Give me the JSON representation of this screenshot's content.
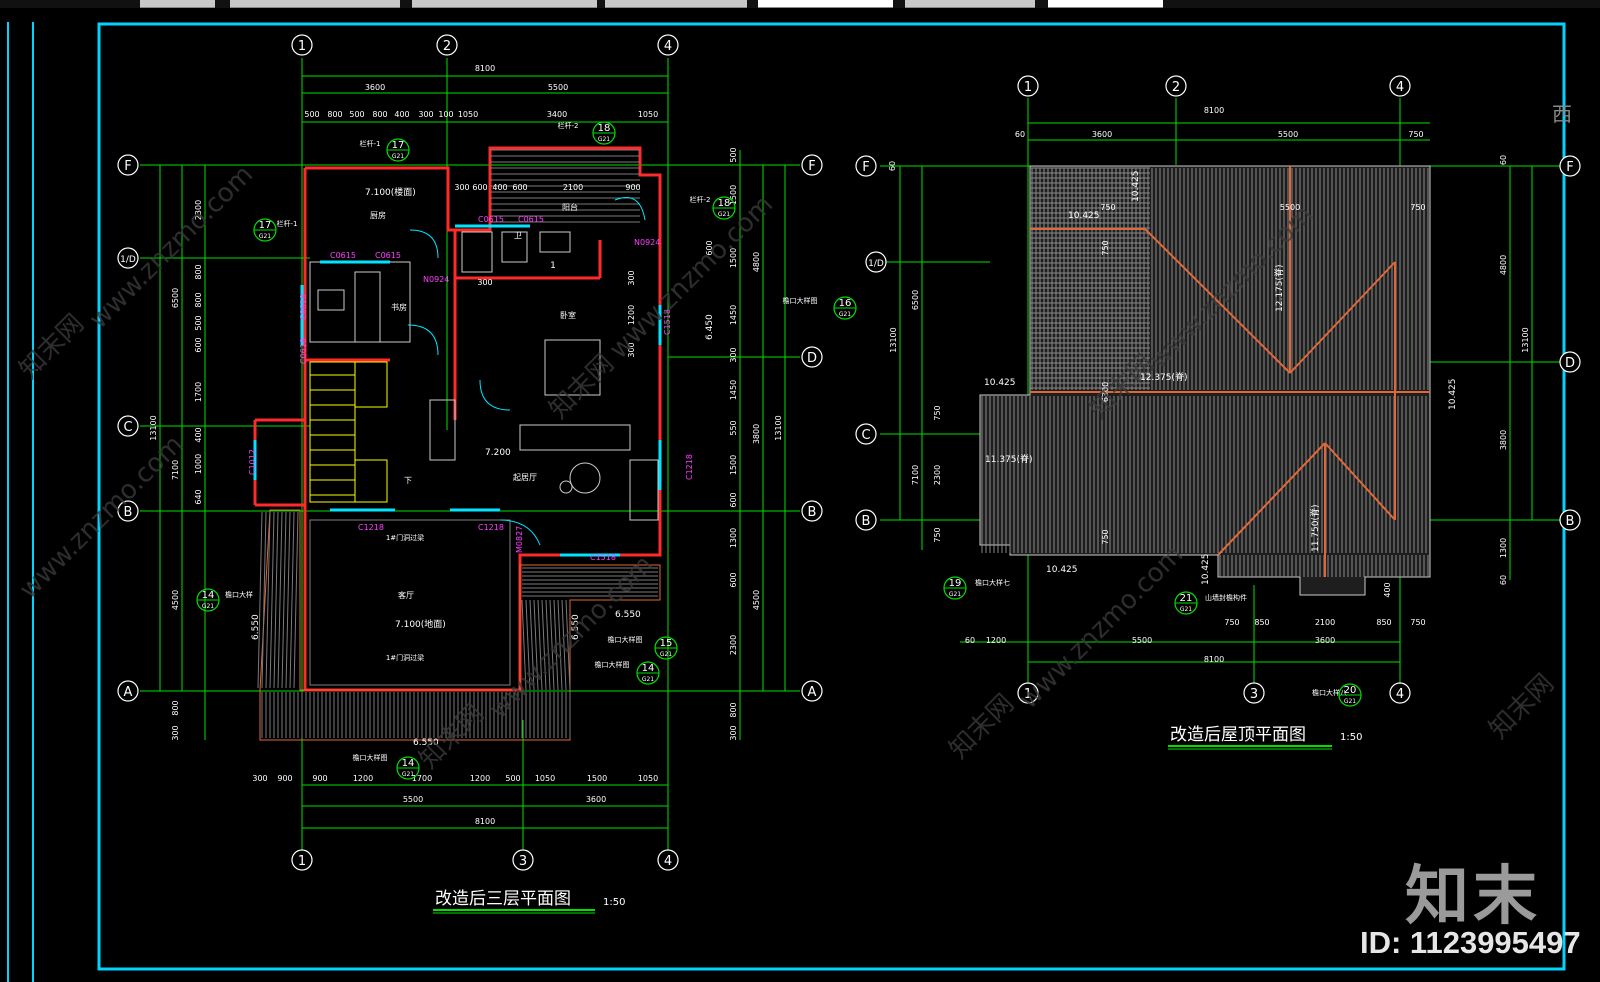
{
  "colors": {
    "background": "#000000",
    "frame": "#00d4ff",
    "dimension": "#00e000",
    "wall": "#ff2a2a",
    "window": "#00e5ff",
    "text": "#ffffff",
    "tag": "#ff40ff",
    "stair": "#ffff00",
    "roof": "#e06838",
    "hatch": "#808080"
  },
  "watermark": {
    "logo": "知末",
    "id": "ID: 1123995497",
    "site": "www.znzmo.com",
    "site_cn": "知末网",
    "side_char": "西"
  },
  "plan3": {
    "title": "改造后三层平面图",
    "scale": "1:50",
    "axes_top": [
      "1",
      "2",
      "4"
    ],
    "axes_bottom": [
      "1",
      "3",
      "4"
    ],
    "axes_rows": [
      "F",
      "1/D",
      "C",
      "B",
      "A"
    ],
    "axes_rows_right": [
      "F",
      "D",
      "B",
      "A"
    ],
    "dim_total_top": "8100",
    "dim_top_mid": [
      "3600",
      "5500"
    ],
    "dim_top_detail": [
      "500",
      "800",
      "500",
      "800",
      "400",
      "300",
      "100",
      "1050",
      "3400",
      "1050"
    ],
    "dim_bottom_detail": [
      "300",
      "900",
      "900",
      "1200",
      "1700",
      "1200",
      "500",
      "1050",
      "1500",
      "1050"
    ],
    "dim_bottom_mid": [
      "5500",
      "3600"
    ],
    "dim_total_bottom": "8100",
    "dim_left_outer": "13100",
    "dim_left_mid": [
      "6500",
      "7100",
      "4500"
    ],
    "dim_left_detail": [
      "2300",
      "800",
      "800",
      "500",
      "600",
      "1700",
      "400",
      "1000",
      "640"
    ],
    "dim_left_tail": [
      "800",
      "300"
    ],
    "dim_right_detail": [
      "500",
      "1500",
      "600",
      "1500",
      "300",
      "1200",
      "300",
      "1450",
      "550",
      "1500",
      "600",
      "1300",
      "600",
      "2300"
    ],
    "dim_right_tail": [
      "800",
      "300"
    ],
    "dim_right_mid": [
      "4800",
      "3800",
      "4500"
    ],
    "dim_right_outer": "13100",
    "dim_interior": [
      "300",
      "600",
      "400",
      "600",
      "2100",
      "900",
      "900"
    ],
    "room_labels": [
      "厨房",
      "阳台",
      "卧室",
      "书房",
      "起居厅",
      "卫",
      "客厅",
      "下"
    ],
    "room_sub": "1",
    "levels": [
      "7.100(楼面)",
      "7.200",
      "7.100(地面)",
      "6.550",
      "6.550",
      "6.550",
      "6.450",
      "6.550"
    ],
    "notes": [
      "1#门洞过梁",
      "1#门洞过梁",
      "栏杆-2",
      "栏杆-2",
      "栏杆-1",
      "檐口大样图",
      "檐口大样",
      "檐口大样图",
      "檐口大样图",
      "檐口大样图"
    ],
    "window_tags": [
      "C0615",
      "C0615",
      "C0615",
      "C0615",
      "N0924",
      "N0924",
      "C0618",
      "C0618",
      "C1518",
      "C1012",
      "C1218",
      "C1218",
      "C1218",
      "M0827",
      "C1518"
    ],
    "callouts": [
      {
        "num": "17",
        "ref": "G21"
      },
      {
        "num": "18",
        "ref": "G21"
      },
      {
        "num": "17",
        "ref": "G21"
      },
      {
        "num": "18",
        "ref": "G21"
      },
      {
        "num": "16",
        "ref": "G21"
      },
      {
        "num": "14",
        "ref": "G21"
      },
      {
        "num": "15",
        "ref": "G21"
      },
      {
        "num": "14",
        "ref": "G21"
      },
      {
        "num": "14",
        "ref": "G21"
      }
    ]
  },
  "roof": {
    "title": "改造后屋顶平面图",
    "scale": "1:50",
    "axes_top": [
      "1",
      "2",
      "4"
    ],
    "axes_bottom": [
      "1",
      "3",
      "4"
    ],
    "axes_rows": [
      "F",
      "1/D",
      "C",
      "B"
    ],
    "axes_rows_right": [
      "F",
      "D",
      "B"
    ],
    "dim_total_top": "8100",
    "dim_top_mid": [
      "3600",
      "5500"
    ],
    "dim_top_edge": [
      "60",
      "750"
    ],
    "dim_bottom_detail": [
      "60",
      "1200",
      "750",
      "850",
      "2100",
      "850",
      "750"
    ],
    "dim_bottom_mid": [
      "5500",
      "3600"
    ],
    "dim_total_bottom": "8100",
    "dim_left": [
      "60",
      "6500",
      "13100",
      "750",
      "7100",
      "2300",
      "750"
    ],
    "dim_right": [
      "60",
      "4800",
      "13100",
      "3800",
      "1300",
      "60"
    ],
    "dim_inner": [
      "750",
      "5500",
      "750",
      "750",
      "750",
      "6300",
      "400"
    ],
    "levels": [
      "10.425",
      "10.425",
      "12.175(脊)",
      "12.375(脊)",
      "10.425",
      "10.425",
      "11.375(脊)",
      "10.425",
      "11.750(脊)",
      "10.425",
      "10.425"
    ],
    "notes": [
      "檐口大样七",
      "山墙封檐构件",
      "檐口大样八"
    ],
    "callouts": [
      {
        "num": "19",
        "ref": "G21"
      },
      {
        "num": "21",
        "ref": "G21"
      },
      {
        "num": "20",
        "ref": "G21"
      }
    ]
  }
}
